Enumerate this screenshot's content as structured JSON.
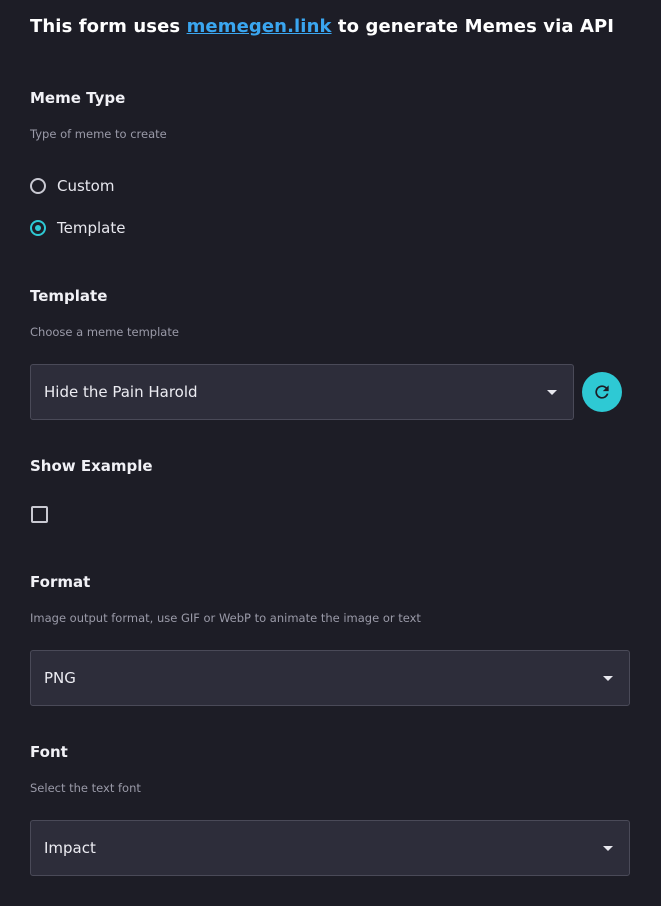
{
  "header": {
    "prefix": "This form uses ",
    "link_text": "memegen.link",
    "suffix": " to generate Memes via API"
  },
  "meme_type": {
    "title": "Meme Type",
    "description": "Type of meme to create",
    "options": [
      {
        "label": "Custom",
        "selected": false
      },
      {
        "label": "Template",
        "selected": true
      }
    ]
  },
  "template": {
    "title": "Template",
    "description": "Choose a meme template",
    "selected_value": "Hide the Pain Harold",
    "refresh_icon": "refresh-icon"
  },
  "show_example": {
    "title": "Show Example",
    "checked": false
  },
  "format": {
    "title": "Format",
    "description": "Image output format, use GIF or WebP to animate the image or text",
    "selected_value": "PNG"
  },
  "font": {
    "title": "Font",
    "description": "Select the text font",
    "selected_value": "Impact"
  },
  "colors": {
    "background": "#1d1d26",
    "accent": "#2ec9d4",
    "link": "#3aa6f0",
    "select_bg": "#2d2d3a"
  }
}
